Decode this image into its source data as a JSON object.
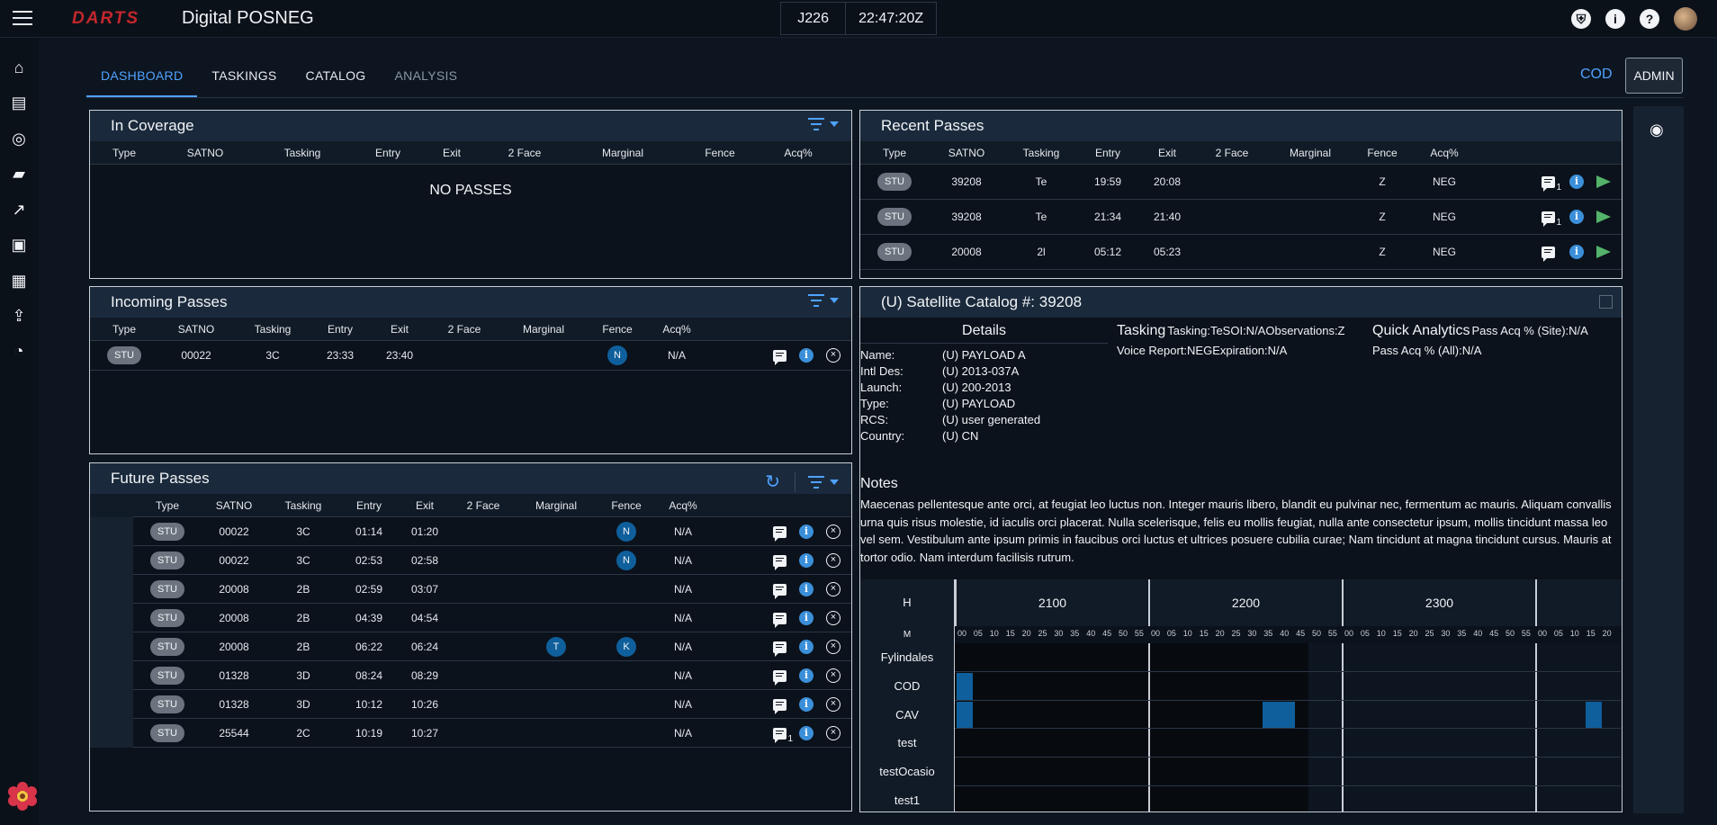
{
  "header": {
    "brand": "DARTS",
    "app_title": "Digital POSNEG",
    "julian_day": "J226",
    "time": "22:47:20Z",
    "icons": [
      "shield-settings-icon",
      "info-icon",
      "help-icon",
      "avatar"
    ]
  },
  "sidebar": {
    "items": [
      "home-icon",
      "document-icon",
      "target-icon",
      "chat-icon",
      "analytics-icon",
      "clipboard-icon",
      "book-icon",
      "upload-icon",
      "gauge-icon"
    ]
  },
  "tabs": [
    {
      "label": "DASHBOARD",
      "state": "active"
    },
    {
      "label": "TASKINGS",
      "state": "normal"
    },
    {
      "label": "CATALOG",
      "state": "normal"
    },
    {
      "label": "ANALYSIS",
      "state": "disabled"
    }
  ],
  "site": {
    "label": "COD",
    "admin_label": "ADMIN"
  },
  "in_coverage": {
    "title": "In Coverage",
    "columns": [
      "Type",
      "SATNO",
      "Tasking",
      "Entry",
      "Exit",
      "2 Face",
      "Marginal",
      "Fence",
      "Acq%"
    ],
    "empty_text": "NO PASSES"
  },
  "incoming": {
    "title": "Incoming Passes",
    "columns": [
      "Type",
      "SATNO",
      "Tasking",
      "Entry",
      "Exit",
      "2 Face",
      "Marginal",
      "Fence",
      "Acq%"
    ],
    "rows": [
      {
        "type": "STU",
        "satno": "00022",
        "tasking": "3C",
        "entry": "23:33",
        "exit": "23:40",
        "marginal": "",
        "fence": "N",
        "acq": "N/A"
      }
    ]
  },
  "future": {
    "title": "Future Passes",
    "columns": [
      "Type",
      "SATNO",
      "Tasking",
      "Entry",
      "Exit",
      "2 Face",
      "Marginal",
      "Fence",
      "Acq%"
    ],
    "rows": [
      {
        "type": "STU",
        "satno": "00022",
        "tasking": "3C",
        "entry": "01:14",
        "exit": "01:20",
        "marginal": "",
        "fence": "N",
        "acq": "N/A",
        "count": ""
      },
      {
        "type": "STU",
        "satno": "00022",
        "tasking": "3C",
        "entry": "02:53",
        "exit": "02:58",
        "marginal": "",
        "fence": "N",
        "acq": "N/A",
        "count": ""
      },
      {
        "type": "STU",
        "satno": "20008",
        "tasking": "2B",
        "entry": "02:59",
        "exit": "03:07",
        "marginal": "",
        "fence": "",
        "acq": "N/A",
        "count": ""
      },
      {
        "type": "STU",
        "satno": "20008",
        "tasking": "2B",
        "entry": "04:39",
        "exit": "04:54",
        "marginal": "",
        "fence": "",
        "acq": "N/A",
        "count": ""
      },
      {
        "type": "STU",
        "satno": "20008",
        "tasking": "2B",
        "entry": "06:22",
        "exit": "06:24",
        "marginal": "T",
        "fence": "K",
        "acq": "N/A",
        "count": ""
      },
      {
        "type": "STU",
        "satno": "01328",
        "tasking": "3D",
        "entry": "08:24",
        "exit": "08:29",
        "marginal": "",
        "fence": "",
        "acq": "N/A",
        "count": ""
      },
      {
        "type": "STU",
        "satno": "01328",
        "tasking": "3D",
        "entry": "10:12",
        "exit": "10:26",
        "marginal": "",
        "fence": "",
        "acq": "N/A",
        "count": ""
      },
      {
        "type": "STU",
        "satno": "25544",
        "tasking": "2C",
        "entry": "10:19",
        "exit": "10:27",
        "marginal": "",
        "fence": "",
        "acq": "N/A",
        "count": "1"
      }
    ]
  },
  "recent": {
    "title": "Recent Passes",
    "columns": [
      "Type",
      "SATNO",
      "Tasking",
      "Entry",
      "Exit",
      "2 Face",
      "Marginal",
      "Fence",
      "Acq%"
    ],
    "rows": [
      {
        "type": "STU",
        "satno": "39208",
        "tasking": "Te",
        "entry": "19:59",
        "exit": "20:08",
        "fence": "Z",
        "acq": "NEG",
        "count": "1"
      },
      {
        "type": "STU",
        "satno": "39208",
        "tasking": "Te",
        "entry": "21:34",
        "exit": "21:40",
        "fence": "Z",
        "acq": "NEG",
        "count": "1"
      },
      {
        "type": "STU",
        "satno": "20008",
        "tasking": "2l",
        "entry": "05:12",
        "exit": "05:23",
        "fence": "Z",
        "acq": "NEG",
        "count": ""
      }
    ]
  },
  "catalog": {
    "title": "(U) Satellite Catalog #: 39208",
    "details_heading": "Details",
    "details": [
      {
        "k": "Name:",
        "v": "(U) PAYLOAD A"
      },
      {
        "k": "Intl Des:",
        "v": "(U) 2013-037A"
      },
      {
        "k": "Launch:",
        "v": "(U) 200-2013"
      },
      {
        "k": "Type:",
        "v": "(U) PAYLOAD"
      },
      {
        "k": "RCS:",
        "v": "(U) user generated"
      },
      {
        "k": "Country:",
        "v": "(U) CN"
      }
    ],
    "tasking_heading": "Tasking",
    "tasking_line1": "Tasking:TeSOI:N/AObservations:Z",
    "tasking_line2": "Voice Report:NEGExpiration:N/A",
    "qa_heading": "Quick Analytics",
    "qa_line1": "Pass Acq % (Site):N/A",
    "qa_line2": "Pass Acq % (All):N/A",
    "notes_heading": "Notes",
    "notes": "Maecenas pellentesque ante orci, at feugiat leo luctus non. Integer mauris libero, blandit eu pulvinar nec, fermentum ac mauris. Aliquam convallis urna quis risus molestie, id iaculis orci placerat. Nulla scelerisque, felis eu mollis feugiat, nulla ante consectetur ipsum, mollis tincidunt massa leo vel sem. Vestibulum ante ipsum primis in faucibus orci luctus et ultrices posuere cubilia curae; Nam tincidunt at magna tincidunt cursus. Mauris at tortor odio. Nam interdum facilisis rutrum."
  },
  "timeline": {
    "h_label": "H",
    "m_label": "M",
    "hours": [
      "2100",
      "2200",
      "2300",
      ""
    ],
    "minutes": [
      "00",
      "05",
      "10",
      "15",
      "20",
      "25",
      "30",
      "35",
      "40",
      "45",
      "50",
      "55"
    ],
    "last_minutes": [
      "00",
      "05",
      "10",
      "15",
      "20"
    ],
    "sites": [
      "Fylindales",
      "COD",
      "CAV",
      "test",
      "testOcasio",
      "test1"
    ],
    "blocks": [
      {
        "site": "COD",
        "hour_index": 0,
        "start_min": 0,
        "end_min": 5
      },
      {
        "site": "CAV",
        "hour_index": 0,
        "start_min": 0,
        "end_min": 5
      },
      {
        "site": "CAV",
        "hour_index": 1,
        "start_min": 35,
        "end_min": 45
      },
      {
        "site": "CAV",
        "hour_index": 3,
        "start_min": 15,
        "end_min": 20
      }
    ],
    "colors": {
      "pass": "#0f5f9c",
      "past": "#070b10"
    }
  },
  "colors": {
    "accent": "#4fa3ff",
    "brand_red": "#c2272d",
    "send_green": "#53b36a",
    "info_blue": "#3b8fd9"
  }
}
